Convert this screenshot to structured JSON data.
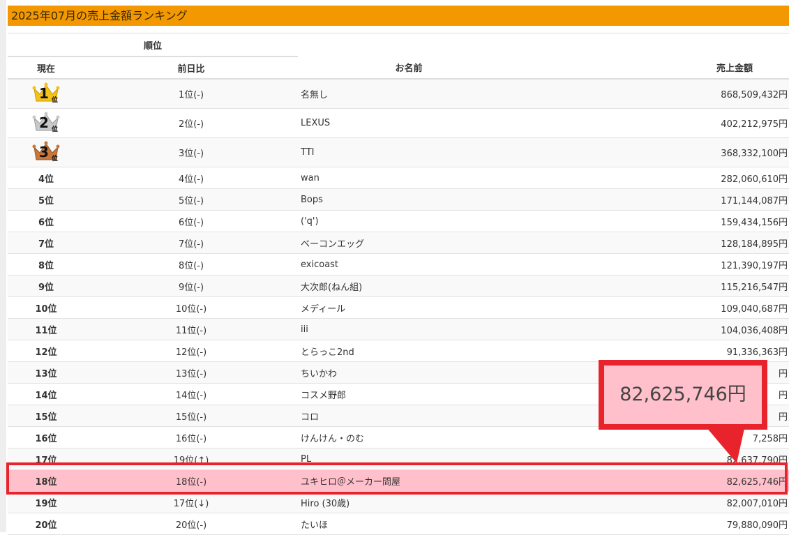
{
  "title": "2025年07月の売上金額ランキング",
  "headers": {
    "rank_group": "順位",
    "current": "現在",
    "previous": "前日比",
    "name": "お名前",
    "amount": "売上金額"
  },
  "rows": [
    {
      "current": "1位",
      "prev": "1位(-)",
      "name": "名無し",
      "amount": "868,509,432円",
      "crown": "gold",
      "crown_num": "1",
      "crown_suffix": "位"
    },
    {
      "current": "2位",
      "prev": "2位(-)",
      "name": "LEXUS",
      "amount": "402,212,975円",
      "crown": "silver",
      "crown_num": "2",
      "crown_suffix": "位"
    },
    {
      "current": "3位",
      "prev": "3位(-)",
      "name": "TTI",
      "amount": "368,332,100円",
      "crown": "bronze",
      "crown_num": "3",
      "crown_suffix": "位"
    },
    {
      "current": "4位",
      "prev": "4位(-)",
      "name": "wan",
      "amount": "282,060,610円"
    },
    {
      "current": "5位",
      "prev": "5位(-)",
      "name": "Bops",
      "amount": "171,144,087円"
    },
    {
      "current": "6位",
      "prev": "6位(-)",
      "name": "('q')",
      "amount": "159,434,156円"
    },
    {
      "current": "7位",
      "prev": "7位(-)",
      "name": "ベーコンエッグ",
      "amount": "128,184,895円"
    },
    {
      "current": "8位",
      "prev": "8位(-)",
      "name": "exicoast",
      "amount": "121,390,197円"
    },
    {
      "current": "9位",
      "prev": "9位(-)",
      "name": "大次郎(ねん組)",
      "amount": "115,216,547円"
    },
    {
      "current": "10位",
      "prev": "10位(-)",
      "name": "メディール",
      "amount": "109,040,687円"
    },
    {
      "current": "11位",
      "prev": "11位(-)",
      "name": "iii",
      "amount": "104,036,408円"
    },
    {
      "current": "12位",
      "prev": "12位(-)",
      "name": "とらっこ2nd",
      "amount": "91,336,363円"
    },
    {
      "current": "13位",
      "prev": "13位(-)",
      "name": "ちいかわ",
      "amount": "円"
    },
    {
      "current": "14位",
      "prev": "14位(-)",
      "name": "コスメ野郎",
      "amount": "円"
    },
    {
      "current": "15位",
      "prev": "15位(-)",
      "name": "コロ",
      "amount": "円"
    },
    {
      "current": "16位",
      "prev": "16位(-)",
      "name": "けんけん・のむ",
      "amount": "7,258円"
    },
    {
      "current": "17位",
      "prev": "19位(↑)",
      "name": "PL",
      "amount": "82,637,790円"
    },
    {
      "current": "18位",
      "prev": "18位(-)",
      "name": "ユキヒロ＠メーカー問屋",
      "amount": "82,625,746円",
      "highlight": true
    },
    {
      "current": "19位",
      "prev": "17位(↓)",
      "name": "Hiro (30歳)",
      "amount": "82,007,010円"
    },
    {
      "current": "20位",
      "prev": "20位(-)",
      "name": "たいほ",
      "amount": "79,880,090円"
    }
  ],
  "callout": {
    "amount": "82,625,746円"
  },
  "colors": {
    "title_bar": "#f39800",
    "highlight": "#ffc0cb",
    "annotation_red": "#e8232b"
  }
}
